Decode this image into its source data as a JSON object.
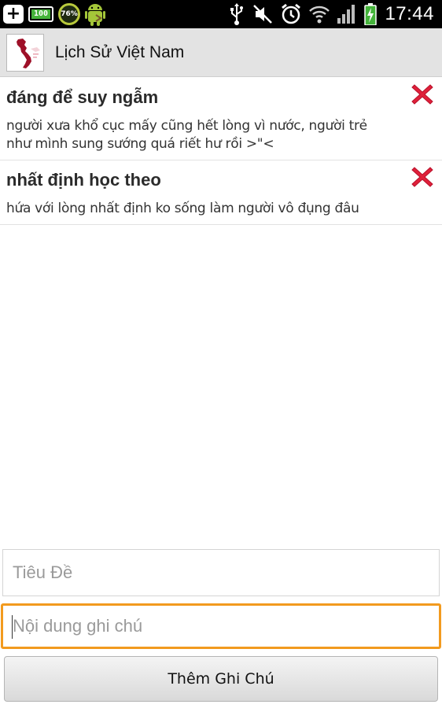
{
  "status_bar": {
    "battery_label": "100",
    "ring_label": "76%",
    "time": "17:44"
  },
  "action_bar": {
    "title": "Lịch Sử Việt Nam"
  },
  "notes": [
    {
      "title": "đáng để suy ngẫm",
      "body": "người xưa khổ cục mấy cũng hết lòng vì nước, người trẻ như mình sung sướng quá riết hư rồi >\"<"
    },
    {
      "title": "nhất định học theo",
      "body": "hứa với lòng nhất định ko sống làm người vô đụng đâu"
    }
  ],
  "form": {
    "title_placeholder": "Tiêu Đề",
    "content_placeholder": "Nội dung ghi chú",
    "add_button_label": "Thêm Ghi Chú"
  },
  "colors": {
    "delete_icon": "#e0203a",
    "focus_border": "#f29a1e",
    "action_bar_bg": "#e3e3e3"
  }
}
